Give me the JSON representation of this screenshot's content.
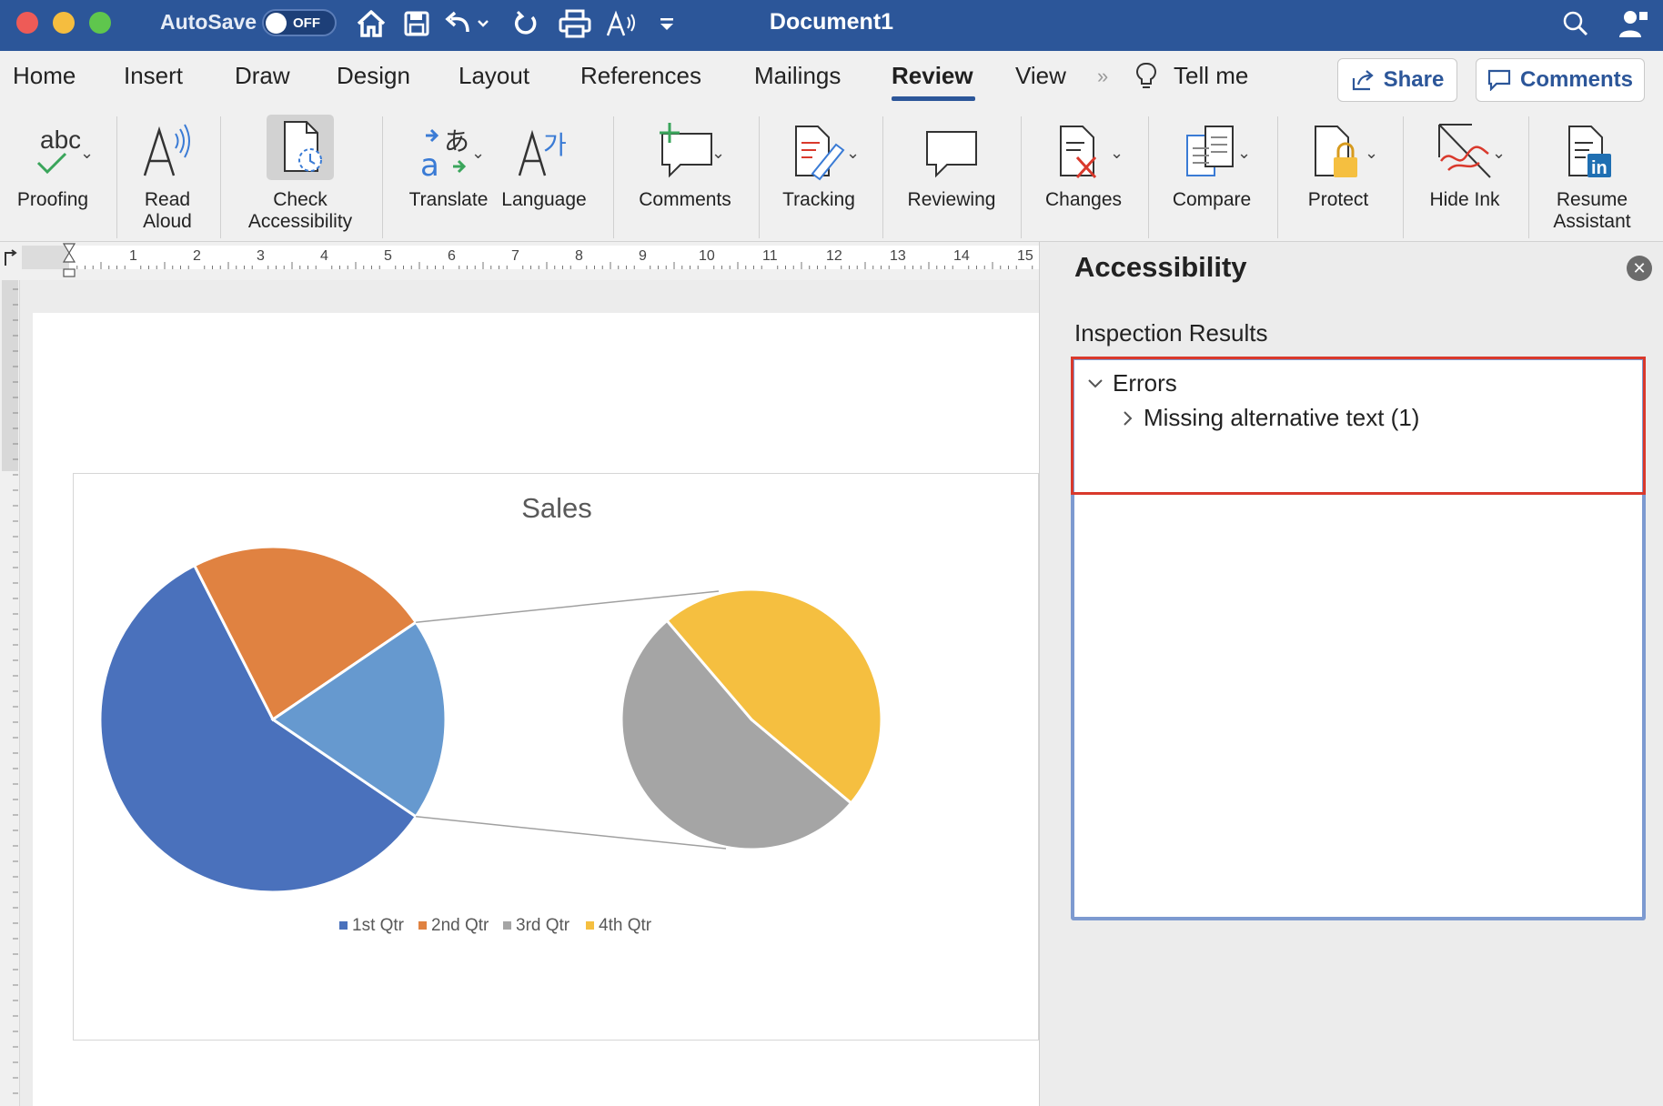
{
  "window": {
    "title": "Document1"
  },
  "titlebar": {
    "autosave_label": "AutoSave",
    "toggle_state": "OFF"
  },
  "tabs": [
    {
      "label": "Home"
    },
    {
      "label": "Insert"
    },
    {
      "label": "Draw"
    },
    {
      "label": "Design"
    },
    {
      "label": "Layout"
    },
    {
      "label": "References"
    },
    {
      "label": "Mailings"
    },
    {
      "label": "Review",
      "active": true
    },
    {
      "label": "View"
    }
  ],
  "tellme": {
    "label": "Tell me"
  },
  "share_button": {
    "label": "Share"
  },
  "comments_button": {
    "label": "Comments"
  },
  "ribbon": {
    "proofing": {
      "line1": "Proofing",
      "icon_text": "abc"
    },
    "read_aloud": {
      "line1": "Read",
      "line2": "Aloud"
    },
    "check_accessibility": {
      "line1": "Check",
      "line2": "Accessibility"
    },
    "translate": {
      "line1": "Translate"
    },
    "language": {
      "line1": "Language"
    },
    "comments": {
      "line1": "Comments"
    },
    "tracking": {
      "line1": "Tracking"
    },
    "reviewing": {
      "line1": "Reviewing"
    },
    "changes": {
      "line1": "Changes"
    },
    "compare": {
      "line1": "Compare"
    },
    "protect": {
      "line1": "Protect"
    },
    "hide_ink": {
      "line1": "Hide Ink"
    },
    "resume_assistant": {
      "line1": "Resume",
      "line2": "Assistant"
    }
  },
  "ruler": {
    "numbers": [
      "1",
      "2",
      "3",
      "4",
      "5",
      "6",
      "7",
      "8",
      "9",
      "10",
      "11",
      "12",
      "13",
      "14",
      "15"
    ]
  },
  "chart_data": {
    "type": "pie",
    "title": "Sales",
    "categories": [
      "1st Qtr",
      "2nd Qtr",
      "3rd Qtr",
      "4th Qtr"
    ],
    "values": [
      58,
      23,
      10,
      9
    ],
    "subtype": "pie-of-pie",
    "secondary_categories": [
      "3rd Qtr",
      "4th Qtr"
    ],
    "colors": [
      "#4a71bc",
      "#e08241",
      "#a5a5a5",
      "#f5bf40"
    ],
    "primary_slice_color_other": "#6699cf",
    "legend_position": "bottom"
  },
  "panel": {
    "title": "Accessibility",
    "inspection_label": "Inspection Results",
    "errors_label": "Errors",
    "missing_alt_label": "Missing alternative text (1)"
  }
}
